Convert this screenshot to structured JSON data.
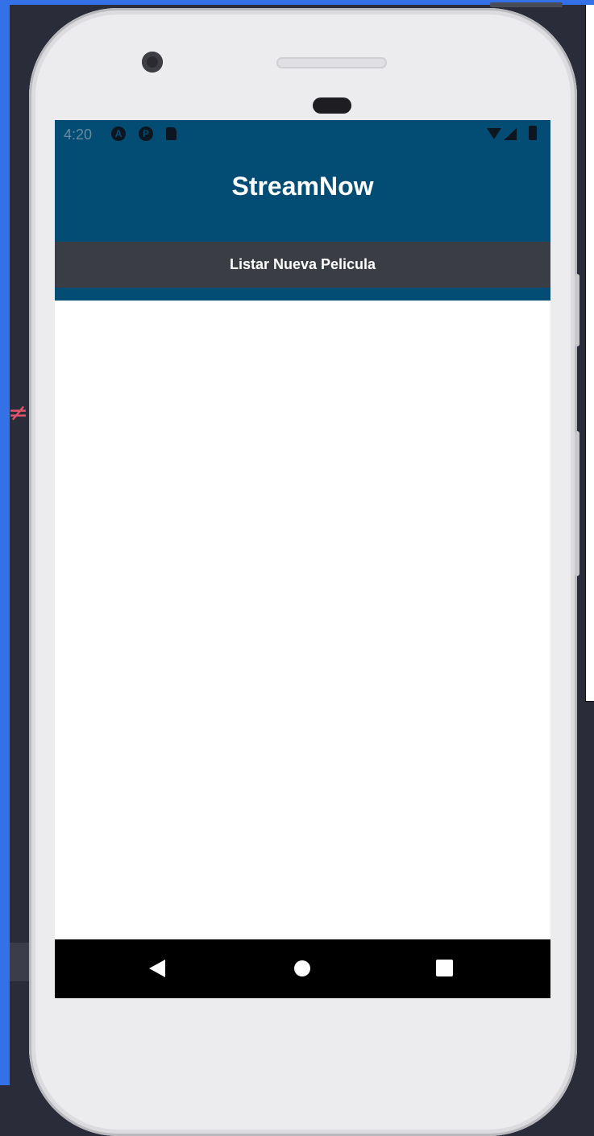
{
  "status_bar": {
    "time": "4:20",
    "icons": [
      "notification-a-icon",
      "notification-p-icon",
      "sd-card-icon",
      "wifi-icon",
      "signal-icon",
      "battery-icon"
    ]
  },
  "header": {
    "title": "StreamNow"
  },
  "actions": {
    "list_new_movie_label": "Listar Nueva Pelicula"
  },
  "navigation": {
    "icons": [
      "back-icon",
      "home-icon",
      "recents-icon"
    ]
  },
  "colors": {
    "header_background": "#034d75",
    "button_background": "#3b3d45",
    "nav_background": "#000000"
  }
}
